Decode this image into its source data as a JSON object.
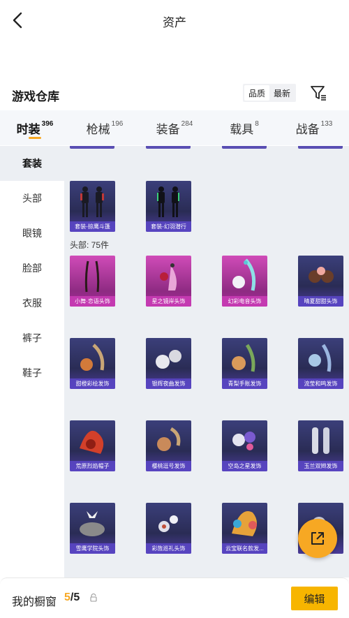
{
  "header": {
    "title": "资产"
  },
  "section": {
    "title": "游戏仓库",
    "sort_options": [
      "品质",
      "最新"
    ],
    "sort_active": 0
  },
  "tabs": [
    {
      "label": "时装",
      "count": "396"
    },
    {
      "label": "枪械",
      "count": "196"
    },
    {
      "label": "装备",
      "count": "284"
    },
    {
      "label": "载具",
      "count": "8"
    },
    {
      "label": "战备",
      "count": "133"
    }
  ],
  "categories": [
    "套装",
    "头部",
    "眼镜",
    "脸部",
    "衣服",
    "裤子",
    "鞋子"
  ],
  "sets": [
    {
      "name": "套装-掠鹰斗篷"
    },
    {
      "name": "套装-幻羽潜行"
    }
  ],
  "head_group_label": "头部: 75件",
  "head_items": [
    {
      "name": "小舞·恋语头饰"
    },
    {
      "name": "星之镜岸头饰"
    },
    {
      "name": "幻彩电音头饰"
    },
    {
      "name": "晴夏甜甜头饰"
    },
    {
      "name": "甜橙彩绘发饰"
    },
    {
      "name": "银辉夜曲发饰"
    },
    {
      "name": "青梨手账发饰"
    },
    {
      "name": "流莹和鸣发饰"
    },
    {
      "name": "荒原烈焰帽子"
    },
    {
      "name": "樱桃逗号发饰"
    },
    {
      "name": "空岛之星发饰"
    },
    {
      "name": "玉兰双辫发饰"
    },
    {
      "name": "雪鹰学院头饰"
    },
    {
      "name": "彩旌巡礼头饰"
    },
    {
      "name": "云宝联名款发..."
    }
  ],
  "bottom": {
    "label": "我的橱窗",
    "current": "5",
    "total": "/5",
    "edit": "编辑"
  },
  "colors": {
    "accent": "#f7a823",
    "card_purple": "#2f3266",
    "card_pink": "#b0339f"
  }
}
